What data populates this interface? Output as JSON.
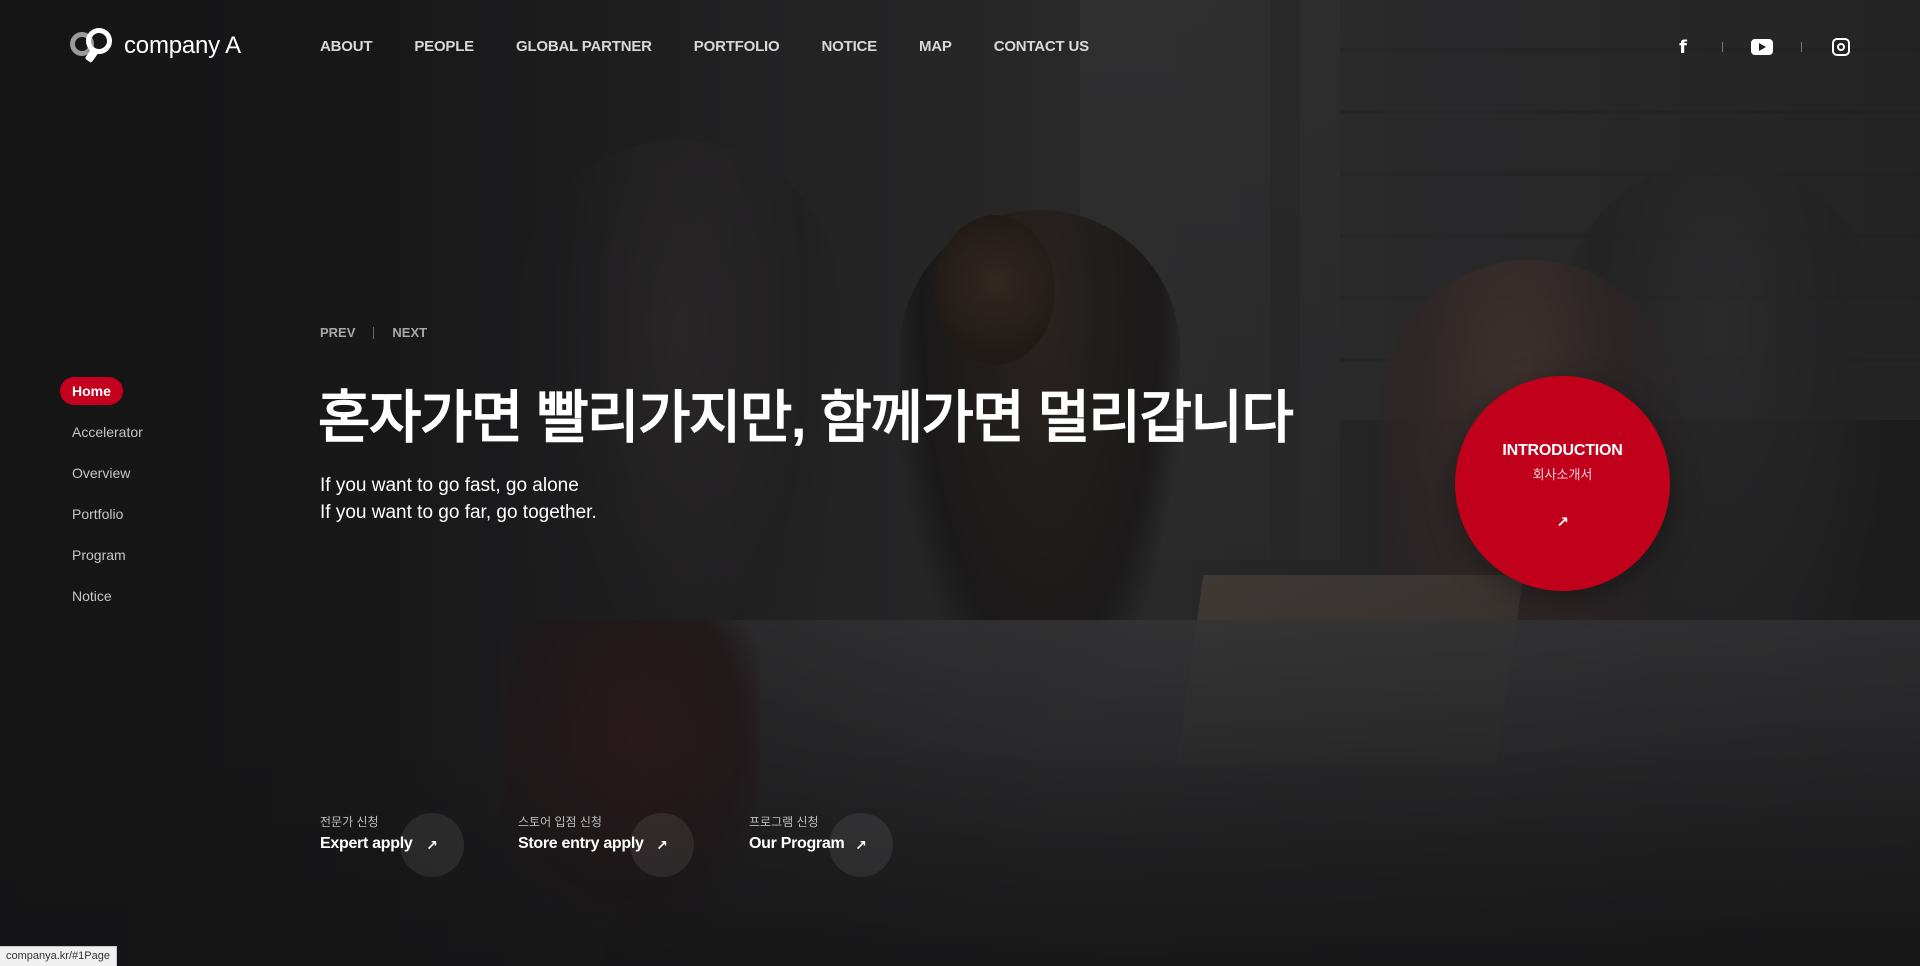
{
  "brand": {
    "name": "company A"
  },
  "nav": {
    "items": [
      "ABOUT",
      "PEOPLE",
      "GLOBAL PARTNER",
      "PORTFOLIO",
      "NOTICE",
      "MAP",
      "CONTACT US"
    ]
  },
  "social": {
    "icons": [
      "facebook-icon",
      "youtube-icon",
      "instagram-icon"
    ]
  },
  "sidebar": {
    "items": [
      {
        "label": "Home",
        "active": true
      },
      {
        "label": "Accelerator",
        "active": false
      },
      {
        "label": "Overview",
        "active": false
      },
      {
        "label": "Portfolio",
        "active": false
      },
      {
        "label": "Program",
        "active": false
      },
      {
        "label": "Notice",
        "active": false
      }
    ]
  },
  "hero": {
    "prev_label": "PREV",
    "next_label": "NEXT",
    "title": "혼자가면 빨리가지만, 함께가면 멀리갑니다",
    "subtitle_line1": "If you want to go fast, go alone",
    "subtitle_line2": "If you want to go far, go together."
  },
  "intro": {
    "title": "INTRODUCTION",
    "subtitle": "회사소개서",
    "arrow": "↗"
  },
  "links": [
    {
      "ko": "전문가 신청",
      "en": "Expert apply",
      "arrow": "↗"
    },
    {
      "ko": "스토어 입점 신청",
      "en": "Store entry apply",
      "arrow": "↗"
    },
    {
      "ko": "프로그램 신청",
      "en": "Our Program",
      "arrow": "↗"
    }
  ],
  "status_bar": {
    "url": "companya.kr/#1Page"
  },
  "colors": {
    "accent": "#c1001c",
    "background": "#1c1c1d"
  }
}
